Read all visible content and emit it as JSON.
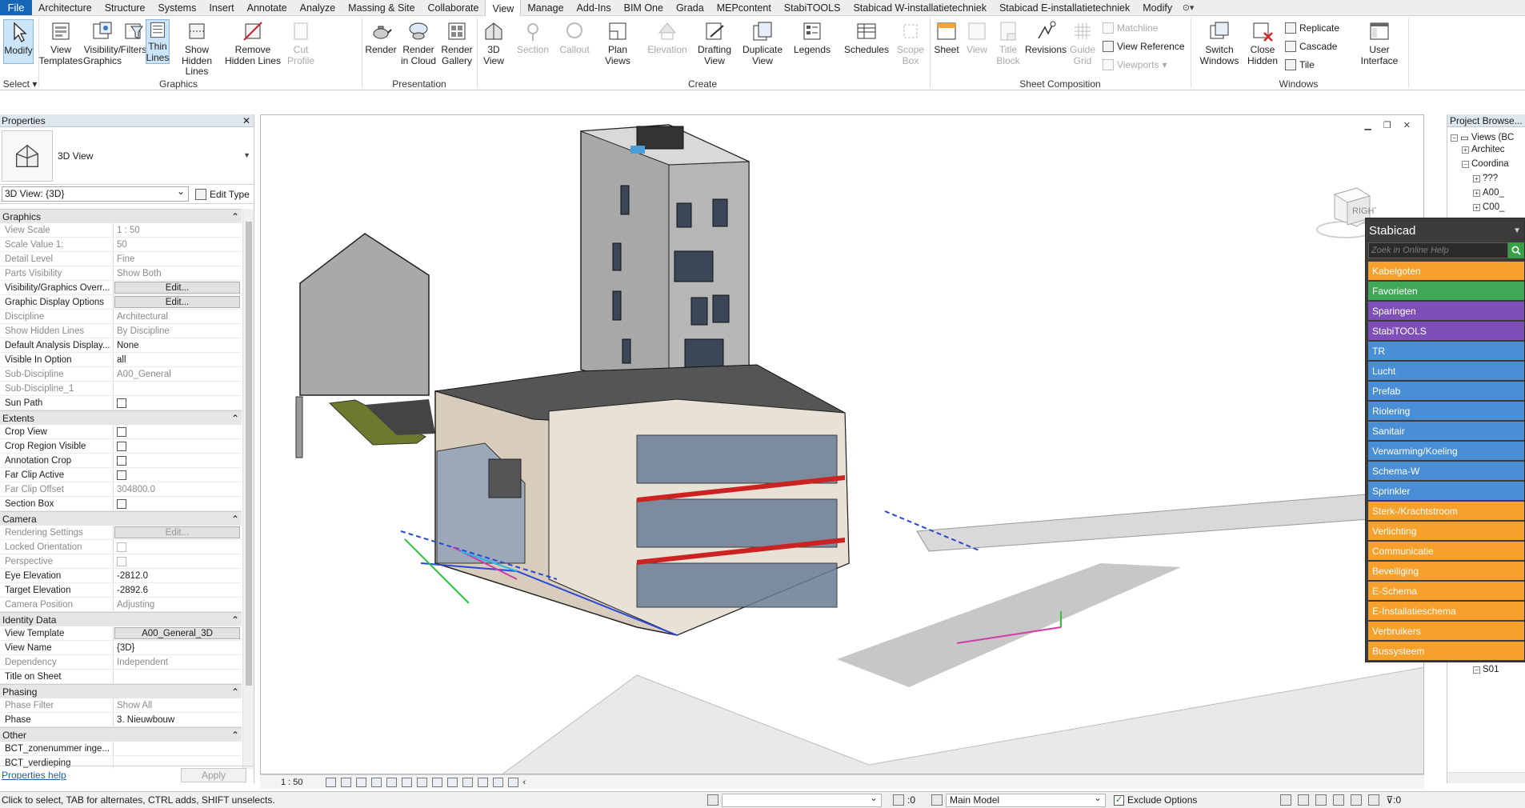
{
  "menu": {
    "file": "File",
    "tabs": [
      "Architecture",
      "Structure",
      "Systems",
      "Insert",
      "Annotate",
      "Analyze",
      "Massing & Site",
      "Collaborate",
      "View",
      "Manage",
      "Add-Ins",
      "BIM One",
      "Grada",
      "MEPcontent",
      "StabiTOOLS",
      "Stabicad W-installatietechniek",
      "Stabicad E-installatietechniek",
      "Modify"
    ],
    "active_tab": "View"
  },
  "ribbon": {
    "modify": [
      "Modify"
    ],
    "select": "Select",
    "graphics_title": "Graphics",
    "view_templates": [
      "View",
      "Templates"
    ],
    "visibility_graphics": [
      "Visibility/",
      "Graphics"
    ],
    "filters": [
      "Filters"
    ],
    "thin_lines": [
      "Thin",
      "Lines"
    ],
    "show_hidden_lines": [
      "Show",
      "Hidden Lines"
    ],
    "remove_hidden_lines": [
      "Remove",
      "Hidden Lines"
    ],
    "cut_profile": [
      "Cut",
      "Profile"
    ],
    "presentation_title": "Presentation",
    "render": [
      "Render"
    ],
    "render_cloud": [
      "Render",
      "in Cloud"
    ],
    "render_gallery": [
      "Render",
      "Gallery"
    ],
    "create_title": "Create",
    "view_3d": [
      "3D",
      "View"
    ],
    "section": [
      "Section"
    ],
    "callout": [
      "Callout"
    ],
    "plan_views": [
      "Plan",
      "Views"
    ],
    "elevation": [
      "Elevation"
    ],
    "drafting_view": [
      "Drafting",
      "View"
    ],
    "duplicate_view": [
      "Duplicate",
      "View"
    ],
    "legends": [
      "Legends"
    ],
    "schedules": [
      "Schedules"
    ],
    "scope_box": [
      "Scope",
      "Box"
    ],
    "sheet_title": "Sheet Composition",
    "sheet": [
      "Sheet"
    ],
    "view": [
      "View"
    ],
    "title_block": [
      "Title",
      "Block"
    ],
    "revisions": [
      "Revisions"
    ],
    "guide_grid": [
      "Guide",
      "Grid"
    ],
    "matchline": "Matchline",
    "view_reference": "View  Reference",
    "viewports": "Viewports",
    "windows_title": "Windows",
    "switch_windows": [
      "Switch",
      "Windows"
    ],
    "close_hidden": [
      "Close",
      "Hidden"
    ],
    "replicate": "Replicate",
    "cascade": "Cascade",
    "tile": "Tile",
    "user_interface": [
      "User",
      "Interface"
    ]
  },
  "properties": {
    "title": "Properties",
    "type_name": "3D View",
    "instance": "3D View: {3D}",
    "edit_type": "Edit Type",
    "groups": [
      {
        "name": "Graphics",
        "rows": [
          {
            "k": "View Scale",
            "v": "1 : 50",
            "ro": true
          },
          {
            "k": "Scale Value    1:",
            "v": "50",
            "ro": true
          },
          {
            "k": "Detail Level",
            "v": "Fine",
            "ro": true
          },
          {
            "k": "Parts Visibility",
            "v": "Show Both",
            "ro": true
          },
          {
            "k": "Visibility/Graphics Overr...",
            "v": "Edit...",
            "btn": true
          },
          {
            "k": "Graphic Display Options",
            "v": "Edit...",
            "btn": true
          },
          {
            "k": "Discipline",
            "v": "Architectural",
            "ro": true
          },
          {
            "k": "Show Hidden Lines",
            "v": "By Discipline",
            "ro": true
          },
          {
            "k": "Default Analysis Display...",
            "v": "None"
          },
          {
            "k": "Visible In Option",
            "v": "all"
          },
          {
            "k": "Sub-Discipline",
            "v": "A00_General",
            "ro": true
          },
          {
            "k": "Sub-Discipline_1",
            "v": "",
            "ro": true
          },
          {
            "k": "Sun Path",
            "v": "",
            "chk": true
          }
        ]
      },
      {
        "name": "Extents",
        "rows": [
          {
            "k": "Crop View",
            "v": "",
            "chk": true
          },
          {
            "k": "Crop Region Visible",
            "v": "",
            "chk": true
          },
          {
            "k": "Annotation Crop",
            "v": "",
            "chk": true
          },
          {
            "k": "Far Clip Active",
            "v": "",
            "chk": true
          },
          {
            "k": "Far Clip Offset",
            "v": "304800.0",
            "ro": true
          },
          {
            "k": "Section Box",
            "v": "",
            "chk": true
          }
        ]
      },
      {
        "name": "Camera",
        "rows": [
          {
            "k": "Rendering Settings",
            "v": "Edit...",
            "btn": true,
            "ro": true
          },
          {
            "k": "Locked Orientation",
            "v": "",
            "chk": true,
            "ro": true
          },
          {
            "k": "Perspective",
            "v": "",
            "chk": true,
            "ro": true
          },
          {
            "k": "Eye Elevation",
            "v": "-2812.0"
          },
          {
            "k": "Target Elevation",
            "v": "-2892.6"
          },
          {
            "k": "Camera Position",
            "v": "Adjusting",
            "ro": true
          }
        ]
      },
      {
        "name": "Identity Data",
        "rows": [
          {
            "k": "View Template",
            "v": "A00_General_3D",
            "btn": true
          },
          {
            "k": "View Name",
            "v": "{3D}"
          },
          {
            "k": "Dependency",
            "v": "Independent",
            "ro": true
          },
          {
            "k": "Title on Sheet",
            "v": ""
          }
        ]
      },
      {
        "name": "Phasing",
        "rows": [
          {
            "k": "Phase Filter",
            "v": "Show All",
            "ro": true
          },
          {
            "k": "Phase",
            "v": "3. Nieuwbouw"
          }
        ]
      },
      {
        "name": "Other",
        "rows": [
          {
            "k": "BCT_zonenummer inge...",
            "v": ""
          },
          {
            "k": "BCT_verdieping",
            "v": ""
          }
        ]
      }
    ],
    "help": "Properties help",
    "apply": "Apply"
  },
  "viewbar": {
    "scale": "1 : 50"
  },
  "viewcube": {
    "face": "RIGHT"
  },
  "browser": {
    "title": "Project Browse...",
    "nodes": [
      "Views (BC",
      "Architec",
      "Coordina",
      "???",
      "A00_",
      "C00_",
      "S01"
    ]
  },
  "stabicad": {
    "title": "Stabicad",
    "search_placeholder": "Zoek in Online Help",
    "items": [
      {
        "label": "Kabelgoten",
        "color": "#f7a02c"
      },
      {
        "label": "Favorieten",
        "color": "#41a85a"
      },
      {
        "label": "Sparingen",
        "color": "#7e4fb9"
      },
      {
        "label": "StabiTOOLS",
        "color": "#7e4fb9"
      },
      {
        "label": "TR",
        "color": "#4a8fd6"
      },
      {
        "label": "Lucht",
        "color": "#4a8fd6"
      },
      {
        "label": "Prefab",
        "color": "#4a8fd6"
      },
      {
        "label": "Riolering",
        "color": "#4a8fd6"
      },
      {
        "label": "Sanitair",
        "color": "#4a8fd6"
      },
      {
        "label": "Verwarming/Koeling",
        "color": "#4a8fd6"
      },
      {
        "label": "Schema-W",
        "color": "#4a8fd6"
      },
      {
        "label": "Sprinkler",
        "color": "#4a8fd6"
      },
      {
        "label": "Sterk-/Krachtstroom",
        "color": "#f7a02c"
      },
      {
        "label": "Verlichting",
        "color": "#f7a02c"
      },
      {
        "label": "Communicatie",
        "color": "#f7a02c"
      },
      {
        "label": "Beveiliging",
        "color": "#f7a02c"
      },
      {
        "label": "E-Schema",
        "color": "#f7a02c"
      },
      {
        "label": "E-Installatieschema",
        "color": "#f7a02c"
      },
      {
        "label": "Verbruikers",
        "color": "#f7a02c"
      },
      {
        "label": "Bussysteem",
        "color": "#f7a02c"
      }
    ]
  },
  "statusbar": {
    "message": "Click to select, TAB for alternates, CTRL adds, SHIFT unselects.",
    "zero1": ":0",
    "model": "Main Model",
    "exclude": "Exclude Options",
    "zero2": ":0"
  },
  "colors": {
    "accent": "#1566b6",
    "ribbon_active": "#cce4f7"
  }
}
